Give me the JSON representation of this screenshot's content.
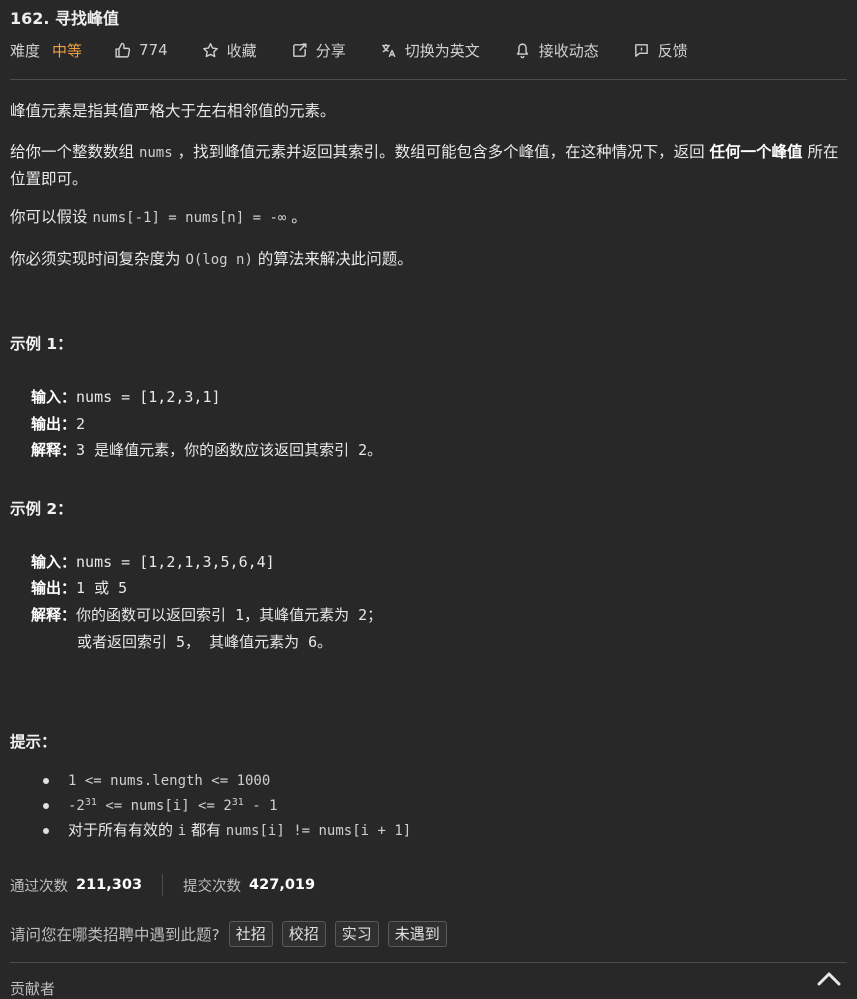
{
  "problem": {
    "title": "162. 寻找峰值"
  },
  "meta": {
    "difficulty_label": "难度",
    "difficulty_value": "中等",
    "likes": "774",
    "favorite": "收藏",
    "share": "分享",
    "switch_lang": "切换为英文",
    "notifications": "接收动态",
    "feedback": "反馈",
    "difficulty_color": "#f0a044"
  },
  "description": {
    "p1": "峰值元素是指其值严格大于左右相邻值的元素。",
    "p2_a": "给你一个整数数组 ",
    "p2_code": "nums",
    "p2_b": " ，找到峰值元素并返回其索引。数组可能包含多个峰值，在这种情况下，返回 ",
    "p2_bold": "任何一个峰值",
    "p2_c": " 所在位置即可。",
    "p3_a": "你可以假设 ",
    "p3_code": "nums[-1] = nums[n] = -∞",
    "p3_b": " 。",
    "p4_a": "你必须实现时间复杂度为 ",
    "p4_code": "O(log n)",
    "p4_b": " 的算法来解决此问题。"
  },
  "examples": [
    {
      "title": "示例 1：",
      "input_label": "输入：",
      "input_value": "nums = [1,2,3,1]",
      "output_label": "输出：",
      "output_value": "2",
      "explain_label": "解释：",
      "explain_value": "3 是峰值元素，你的函数应该返回其索引 2。"
    },
    {
      "title": "示例 2：",
      "input_label": "输入：",
      "input_value": "nums = [1,2,1,3,5,6,4]",
      "output_label": "输出：",
      "output_value": "1 或 5",
      "explain_label": "解释：",
      "explain_value": "你的函数可以返回索引 1，其峰值元素为 2；",
      "explain_value_2": "或者返回索引 5， 其峰值元素为 6。"
    }
  ],
  "hints": {
    "title": "提示：",
    "h1": "1 <= nums.length <= 1000",
    "h2_a": "-2",
    "h2_sup1": "31",
    "h2_b": " <= nums[i] <= 2",
    "h2_sup2": "31",
    "h2_c": " - 1",
    "h3_a": "对于所有有效的 ",
    "h3_code1": "i",
    "h3_b": " 都有 ",
    "h3_code2": "nums[i] != nums[i + 1]"
  },
  "stats": {
    "accepted_label": "通过次数",
    "accepted_value": "211,303",
    "submitted_label": "提交次数",
    "submitted_value": "427,019"
  },
  "question": {
    "text": "请问您在哪类招聘中遇到此题?",
    "options": [
      "社招",
      "校招",
      "实习",
      "未遇到"
    ]
  },
  "footer": {
    "contributor": "贡献者"
  }
}
